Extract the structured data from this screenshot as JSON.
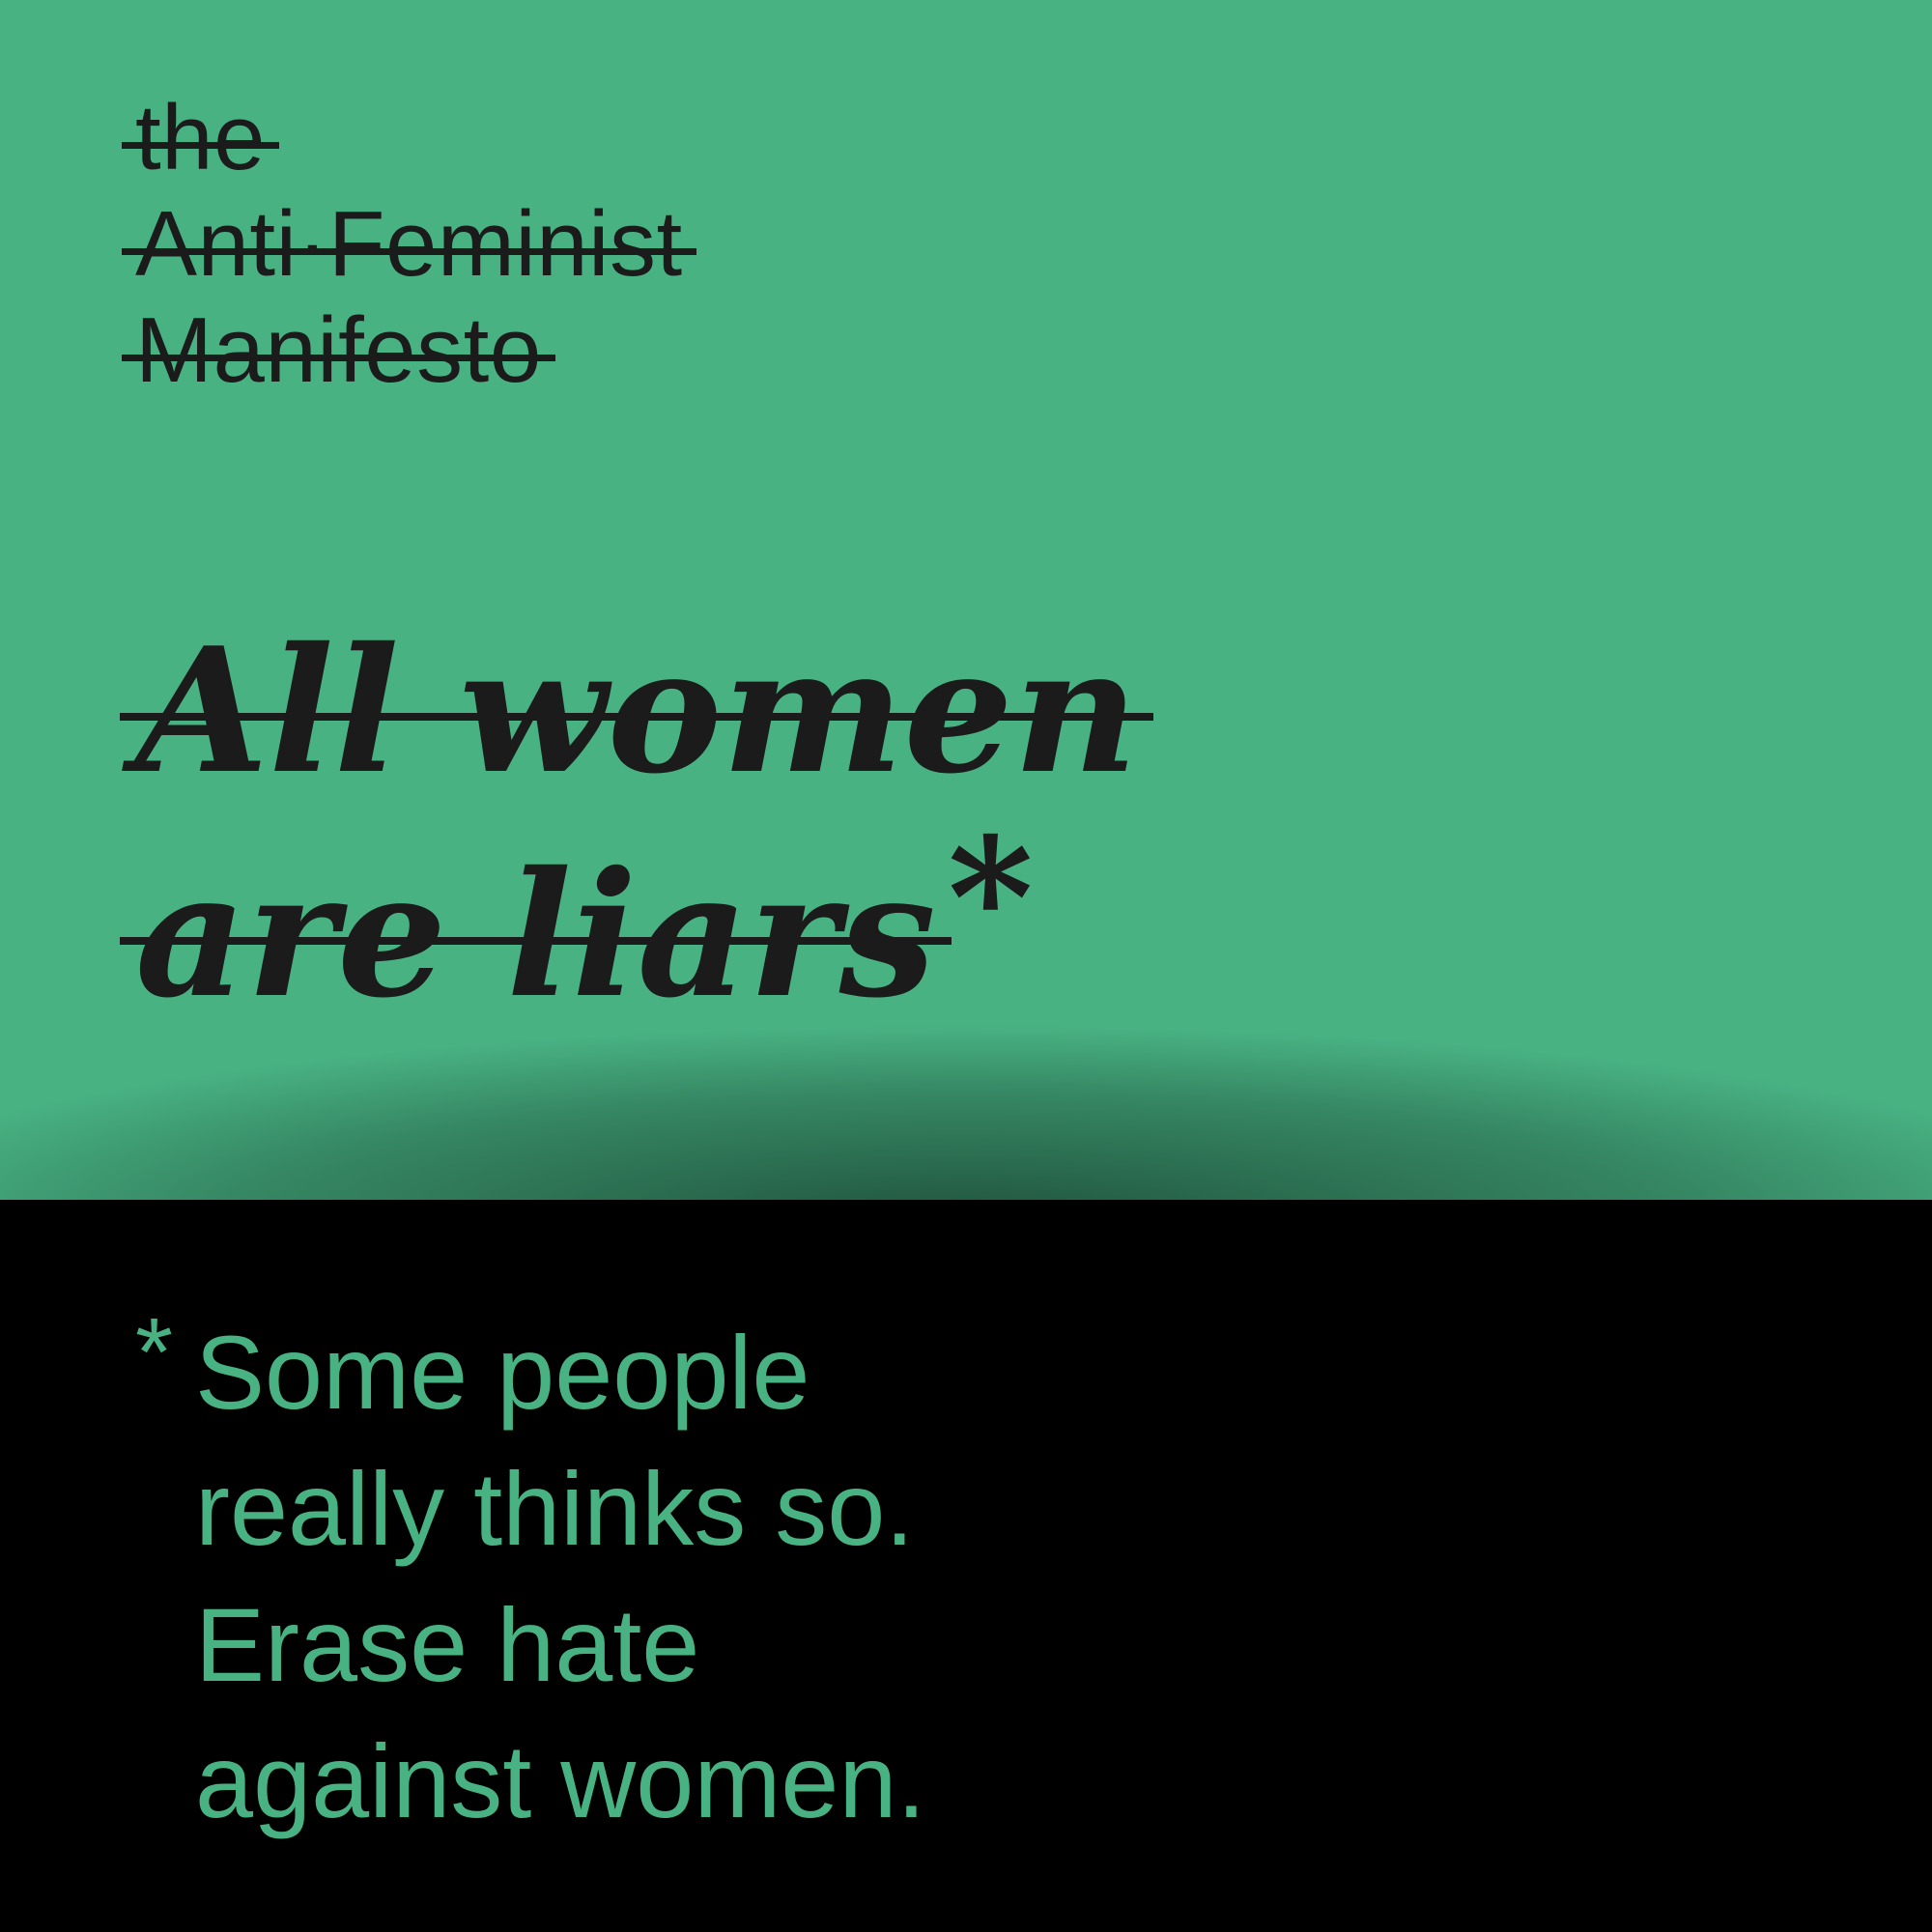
{
  "colors": {
    "green": "#48b283",
    "black": "#000000",
    "ink": "#1b1b1b"
  },
  "title": {
    "lines": [
      "the",
      "Anti·Feminist",
      "Manifesto"
    ]
  },
  "headline": {
    "line1": "All women",
    "line2": "are liars",
    "asterisk": "*"
  },
  "footnote": {
    "mark": "*",
    "lines": [
      "Some people",
      "really thinks so.",
      "Erase hate",
      "against women."
    ]
  }
}
